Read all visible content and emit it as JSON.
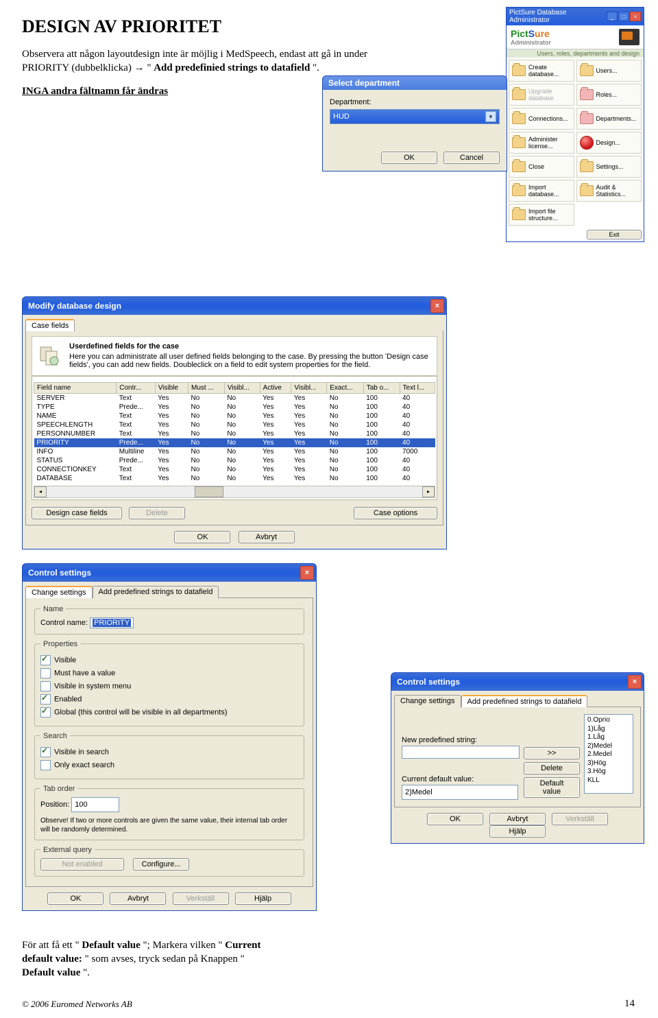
{
  "doc": {
    "title": "DESIGN AV PRIORITET",
    "intro_a": "Observera att någon layoutdesign inte är möjlig i MedSpeech, endast att gå in under PRIORITY (dubbelklicka) ",
    "arrow": "→",
    "intro_b": " \"",
    "intro_bold": "Add predefinied strings to datafield",
    "intro_c": "\".",
    "warn": "INGA andra fältnamn får ändras",
    "bottom_a": "För att få ett \"",
    "bottom_bold1": "Default value",
    "bottom_b": "\"; Markera vilken \"",
    "bottom_bold2": "Current default value:",
    "bottom_c": "\" som avses, tryck sedan på Knappen \"",
    "bottom_bold3": "Default value",
    "bottom_d": "\".",
    "copyright": "© 2006 Euromed Networks AB",
    "pagenum": "14"
  },
  "select_dept": {
    "title": "Select department",
    "label": "Department:",
    "value": "HUD",
    "ok": "OK",
    "cancel": "Cancel"
  },
  "pictsure": {
    "wintitle": "PictSure Database Administrator",
    "logo_a": "Pict",
    "logo_b": "S",
    "logo_c": "ure",
    "subtitle_a": "Administrator",
    "subtitle_b": "Users, roles, departments and design",
    "cells": [
      {
        "label": "Create database...",
        "dis": false
      },
      {
        "label": "Users...",
        "dis": false
      },
      {
        "label": "Upgrade database",
        "dis": true
      },
      {
        "label": "Roles...",
        "dis": false,
        "icon": "red"
      },
      {
        "label": "Connections...",
        "dis": false
      },
      {
        "label": "Departments...",
        "dis": false,
        "icon": "red"
      },
      {
        "label": "Administer license...",
        "dis": false
      },
      {
        "label": "Design...",
        "dis": false,
        "icon": "dot"
      },
      {
        "label": "Close",
        "dis": false
      },
      {
        "label": "Settings...",
        "dis": false
      },
      {
        "label": "Import database...",
        "dis": false
      },
      {
        "label": "Audit & Statistics...",
        "dis": false
      },
      {
        "label": "Import file structure...",
        "dis": false
      }
    ],
    "exit": "Exit"
  },
  "modify": {
    "title": "Modify database design",
    "tab": "Case fields",
    "desc_title": "Userdefined fields for the case",
    "desc_text": "Here you can administrate all user defined fields belonging to the case. By pressing the button 'Design case fields', you can add new fields. Doubleclick on a field to edit system properties for the field.",
    "headers": [
      "Field name",
      "Contr...",
      "Visible",
      "Must ...",
      "Visibl...",
      "Active",
      "Visibl...",
      "Exact...",
      "Tab o...",
      "Text l..."
    ],
    "rows": [
      [
        "SERVER",
        "Text",
        "Yes",
        "No",
        "No",
        "Yes",
        "Yes",
        "No",
        "100",
        "40"
      ],
      [
        "TYPE",
        "Prede...",
        "Yes",
        "No",
        "No",
        "Yes",
        "Yes",
        "No",
        "100",
        "40"
      ],
      [
        "NAME",
        "Text",
        "Yes",
        "No",
        "No",
        "Yes",
        "Yes",
        "No",
        "100",
        "40"
      ],
      [
        "SPEECHLENGTH",
        "Text",
        "Yes",
        "No",
        "No",
        "Yes",
        "Yes",
        "No",
        "100",
        "40"
      ],
      [
        "PERSONNUMBER",
        "Text",
        "Yes",
        "No",
        "No",
        "Yes",
        "Yes",
        "No",
        "100",
        "40"
      ],
      [
        "PRIORITY",
        "Prede...",
        "Yes",
        "No",
        "No",
        "Yes",
        "Yes",
        "No",
        "100",
        "40"
      ],
      [
        "INFO",
        "Multiline",
        "Yes",
        "No",
        "No",
        "Yes",
        "Yes",
        "No",
        "100",
        "7000"
      ],
      [
        "STATUS",
        "Prede...",
        "Yes",
        "No",
        "No",
        "Yes",
        "Yes",
        "No",
        "100",
        "40"
      ],
      [
        "CONNECTIONKEY",
        "Text",
        "Yes",
        "No",
        "No",
        "Yes",
        "Yes",
        "No",
        "100",
        "40"
      ],
      [
        "DATABASE",
        "Text",
        "Yes",
        "No",
        "No",
        "Yes",
        "Yes",
        "No",
        "100",
        "40"
      ]
    ],
    "sel_row": 5,
    "btn_design": "Design case fields",
    "btn_delete": "Delete",
    "btn_options": "Case options",
    "ok": "OK",
    "cancel": "Avbryt"
  },
  "ctrl": {
    "title": "Control settings",
    "tab_change": "Change settings",
    "tab_add": "Add predefined strings to datafield",
    "leg_name": "Name",
    "lbl_control_name": "Control name:",
    "val_control_name": "PRIORITY",
    "leg_props": "Properties",
    "chk_visible": "Visible",
    "chk_must": "Must have a value",
    "chk_sysmenu": "Visible in system menu",
    "chk_enabled": "Enabled",
    "chk_global": "Global (this control will be visible in all departments)",
    "leg_search": "Search",
    "chk_vis_search": "Visible in search",
    "chk_exact": "Only exact search",
    "leg_tab": "Tab order",
    "lbl_pos": "Position:",
    "val_pos": "100",
    "tab_note": "Observe! If two or more controls are given the same value, their internal tab order will be randomly determined.",
    "leg_ext": "External query",
    "not_enabled": "Not enabled",
    "configure": "Configure...",
    "ok": "OK",
    "cancel": "Avbryt",
    "apply": "Verkställ",
    "help": "Hjälp"
  },
  "add": {
    "title": "Control settings",
    "tab_change": "Change settings",
    "tab_add": "Add predefined strings to datafield",
    "lbl_new": "New predefined string:",
    "btn_add": ">>",
    "btn_del": "Delete",
    "btn_default": "Default value",
    "lbl_current": "Current default value:",
    "val_current": "2)Medel",
    "list": [
      "0.Oprio",
      "1)Låg",
      "1.Låg",
      "2)Medel",
      "2.Medel",
      "3)Hög",
      "3.Hög",
      "KLL"
    ],
    "ok": "OK",
    "cancel": "Avbryt",
    "apply": "Verkställ",
    "help": "Hjälp"
  }
}
